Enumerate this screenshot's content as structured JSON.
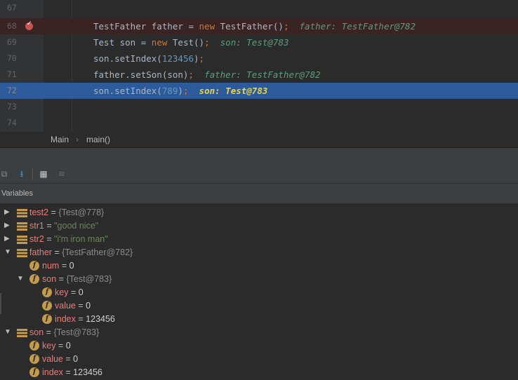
{
  "editor": {
    "lines": [
      {
        "num": "67",
        "code": []
      },
      {
        "num": "68",
        "code": [
          {
            "t": "TestFather father = ",
            "c": ""
          },
          {
            "t": "new",
            "c": "kw"
          },
          {
            "t": " TestFather()",
            "c": ""
          },
          {
            "t": ";",
            "c": "kw"
          }
        ],
        "inline": "father: TestFather@782"
      },
      {
        "num": "69",
        "code": [
          {
            "t": "Test son = ",
            "c": ""
          },
          {
            "t": "new",
            "c": "kw"
          },
          {
            "t": " Test()",
            "c": ""
          },
          {
            "t": ";",
            "c": "kw"
          }
        ],
        "inline": "son: Test@783"
      },
      {
        "num": "70",
        "code": [
          {
            "t": "son.setIndex(",
            "c": ""
          },
          {
            "t": "123456",
            "c": "num"
          },
          {
            "t": ")",
            "c": ""
          },
          {
            "t": ";",
            "c": "kw"
          }
        ]
      },
      {
        "num": "71",
        "code": [
          {
            "t": "father.setSon(son)",
            "c": ""
          },
          {
            "t": ";",
            "c": "kw"
          }
        ],
        "inline": "father: TestFather@782"
      },
      {
        "num": "72",
        "code": [
          {
            "t": "son.setIndex(",
            "c": ""
          },
          {
            "t": "789",
            "c": "num"
          },
          {
            "t": ")",
            "c": ""
          },
          {
            "t": ";",
            "c": "kw"
          }
        ],
        "inline": "son: Test@783"
      },
      {
        "num": "73",
        "code": []
      },
      {
        "num": "74",
        "code": []
      }
    ]
  },
  "breadcrumb": {
    "class": "Main",
    "separator": "›",
    "method": "main()"
  },
  "toolbar": {
    "icons": [
      "restore-layout-icon",
      "step-into-icon",
      "table-view-icon",
      "mute-icon"
    ]
  },
  "variables": {
    "title": "Variables",
    "rows": [
      {
        "name": "test2",
        "eq": "=",
        "value": "{Test@778}",
        "kind": "obj"
      },
      {
        "name": "str1",
        "eq": "=",
        "value": "\"good nice\"",
        "kind": "str"
      },
      {
        "name": "str2",
        "eq": "=",
        "value": "\"i'm iron man\"",
        "kind": "str"
      },
      {
        "name": "father",
        "eq": "=",
        "value": "{TestFather@782}",
        "kind": "obj"
      },
      {
        "name": "num",
        "eq": "=",
        "value": "0",
        "kind": "num"
      },
      {
        "name": "son",
        "eq": "=",
        "value": "{Test@783}",
        "kind": "obj"
      },
      {
        "name": "key",
        "eq": "=",
        "value": "0",
        "kind": "num"
      },
      {
        "name": "value",
        "eq": "=",
        "value": "0",
        "kind": "num"
      },
      {
        "name": "index",
        "eq": "=",
        "value": "123456",
        "kind": "num"
      },
      {
        "name": "son",
        "eq": "=",
        "value": "{Test@783}",
        "kind": "obj"
      },
      {
        "name": "key",
        "eq": "=",
        "value": "0",
        "kind": "num"
      },
      {
        "name": "value",
        "eq": "=",
        "value": "0",
        "kind": "num"
      },
      {
        "name": "index",
        "eq": "=",
        "value": "123456",
        "kind": "num"
      }
    ]
  },
  "colors": {
    "selection": "#2d5a9a",
    "breakpoint_line": "#3a2323",
    "breakpoint": "#c75450",
    "keyword": "#cc7832",
    "number": "#6897bb",
    "inline_value": "#5e9b7f",
    "var_name": "#ee7b7b"
  }
}
